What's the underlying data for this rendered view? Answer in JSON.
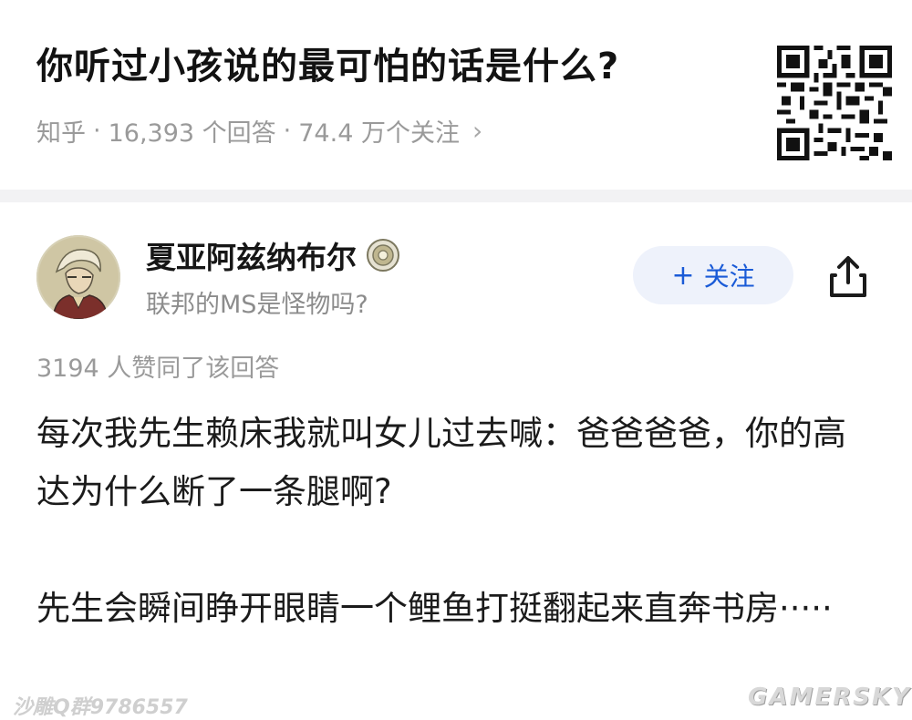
{
  "question": {
    "title": "你听过小孩说的最可怕的话是什么?",
    "source": "知乎",
    "answer_count": "16,393 个回答",
    "follower_count": "74.4 万个关注",
    "chevron": "›"
  },
  "author": {
    "name": "夏亚阿兹纳布尔",
    "bio": "联邦的MS是怪物吗?",
    "follow_label": "关注",
    "follow_plus": "+"
  },
  "answer": {
    "votes": "3194 人赞同了该回答",
    "paragraphs": [
      "每次我先生赖床我就叫女儿过去喊：爸爸爸爸，你的高达为什么断了一条腿啊?",
      "先生会瞬间睁开眼睛一个鲤鱼打挺翻起来直奔书房·····"
    ]
  },
  "watermarks": {
    "left": "沙雕Q群9786557",
    "right": "GAMERSKY"
  },
  "colors": {
    "accent": "#1a5bd7",
    "follow_bg": "#eef2fb",
    "meta_text": "#9a9a9a"
  },
  "icons": {
    "share": "share-icon",
    "badge": "certified-badge-icon",
    "qr": "qr-code-icon"
  }
}
